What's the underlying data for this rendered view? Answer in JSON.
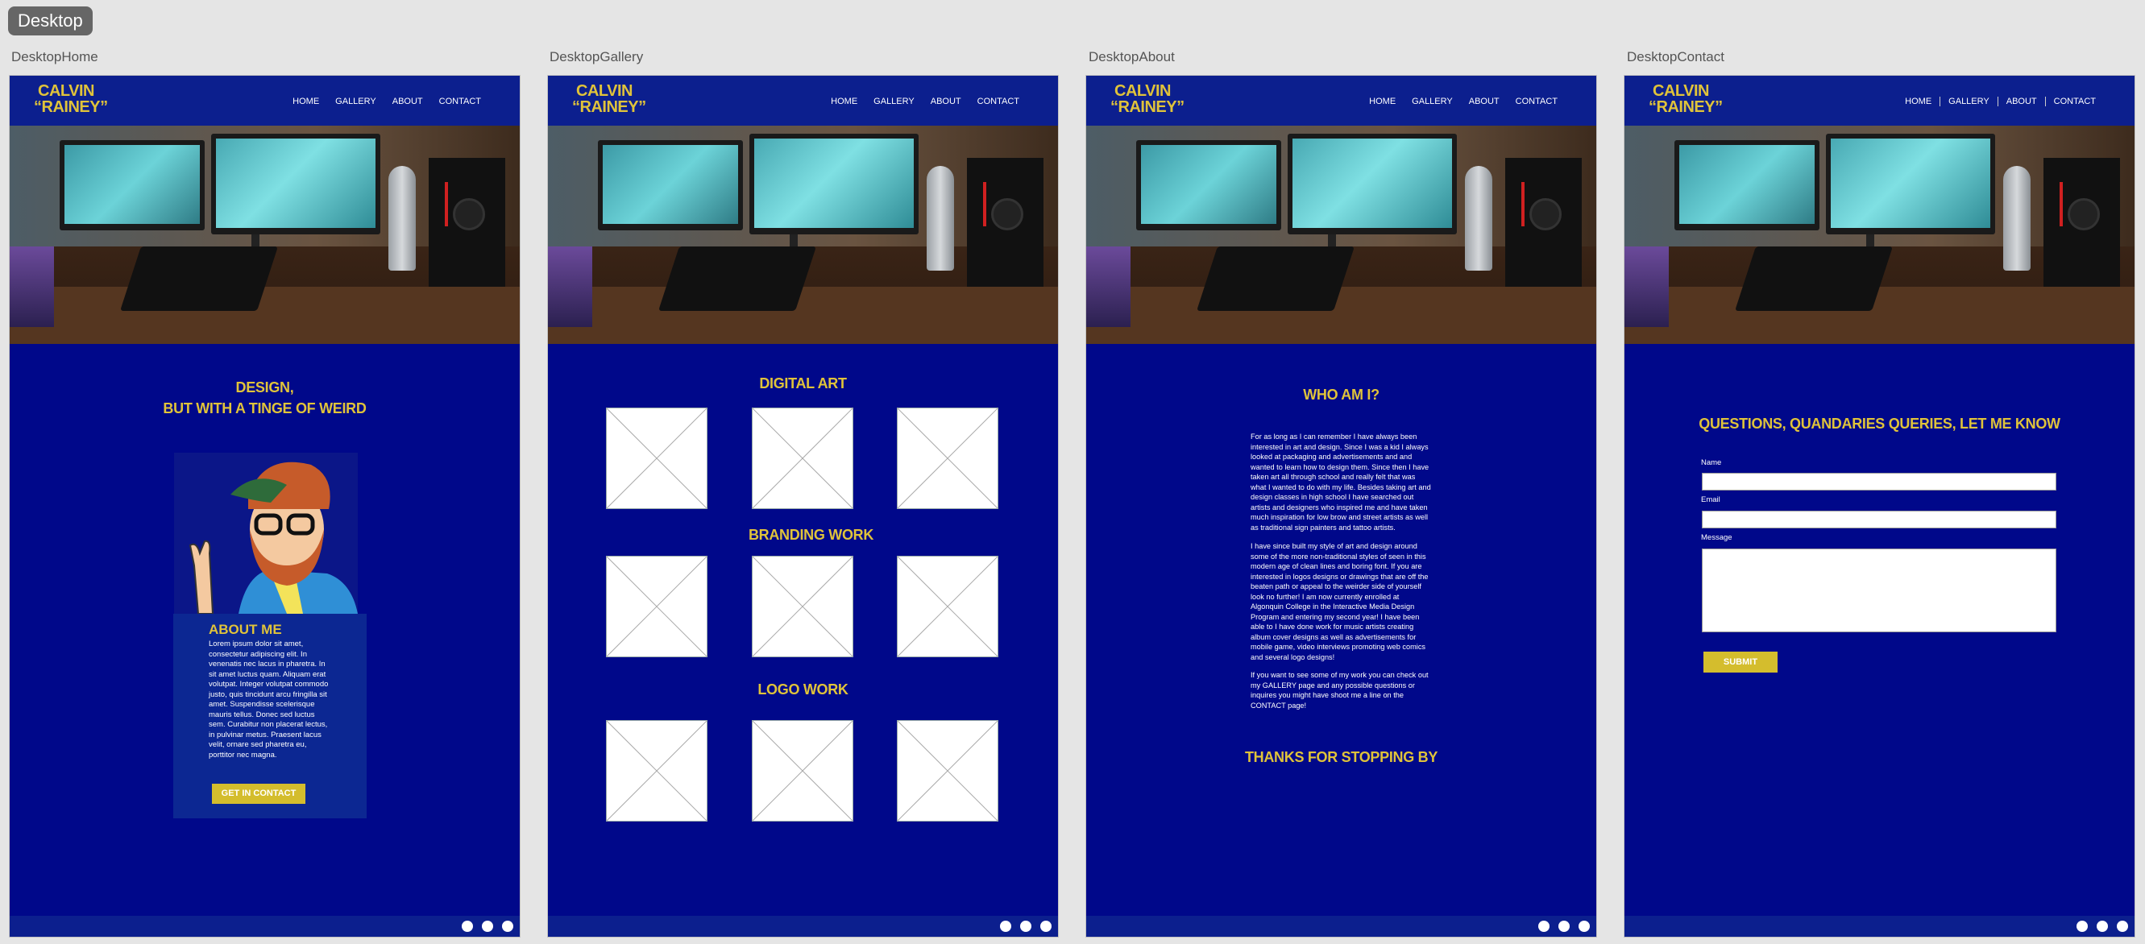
{
  "canvas_label": "Desktop",
  "brand": {
    "line1": "CALVIN",
    "line2": "“RAINEY”",
    "accent": "#e0c33a",
    "background": "#00088a",
    "nav_bg": "#0c1f8e"
  },
  "nav": [
    "HOME",
    "GALLERY",
    "ABOUT",
    "CONTACT"
  ],
  "frames": {
    "home": {
      "label": "DesktopHome",
      "headline_1": "DESIGN,",
      "headline_2": "BUT WITH A TINGE OF WEIRD",
      "about_title": "ABOUT ME",
      "about_body": "Lorem ipsum dolor sit amet, consectetur adipiscing elit. In venenatis nec lacus in pharetra. In sit amet luctus quam. Aliquam erat volutpat. Integer volutpat commodo justo, quis tincidunt arcu fringilla sit amet. Suspendisse scelerisque mauris tellus. Donec sed luctus sem. Curabitur non placerat lectus, in pulvinar metus. Praesent lacus velit, ornare sed pharetra eu, porttitor nec magna.",
      "cta": "GET IN CONTACT"
    },
    "gallery": {
      "label": "DesktopGallery",
      "sections": [
        "DIGITAL ART",
        "BRANDING WORK",
        "LOGO WORK"
      ]
    },
    "about": {
      "label": "DesktopAbout",
      "title": "WHO AM I?",
      "para1": "For as long as I can remember I have always been interested in art and design. Since I was a kid I always looked at packaging and advertisements and and wanted to learn how to design them. Since then I have taken art all through school and really felt that was what I wanted to do with my life. Besides taking art and design classes in high school I have searched out artists and designers who inspired me and have taken much inspiration for low brow and street artists as well as traditional sign painters and tattoo artists.",
      "para2": "I have since built my style of art and design around some of the more non-traditional styles of seen in this modern age of clean lines and boring font. If you are interested in logos designs or drawings that are off the beaten path or appeal to the weirder side of yourself look no further! I am now currently enrolled at Algonquin College in the Interactive Media Design Program and entering my second year! I have been able to I have done work for music artists creating album cover designs as well as advertisements for mobile game, video interviews promoting web comics and several logo designs!",
      "para3": "If you want to see some of my work you can check out my GALLERY page and any possible questions or inquires you might have shoot me a line on the CONTACT page!",
      "thanks": "THANKS FOR STOPPING BY"
    },
    "contact": {
      "label": "DesktopContact",
      "title": "QUESTIONS, QUANDARIES QUERIES, LET ME KNOW",
      "name_label": "Name",
      "email_label": "Email",
      "message_label": "Message",
      "submit": "SUBMIT"
    }
  },
  "footer_dots": 3
}
